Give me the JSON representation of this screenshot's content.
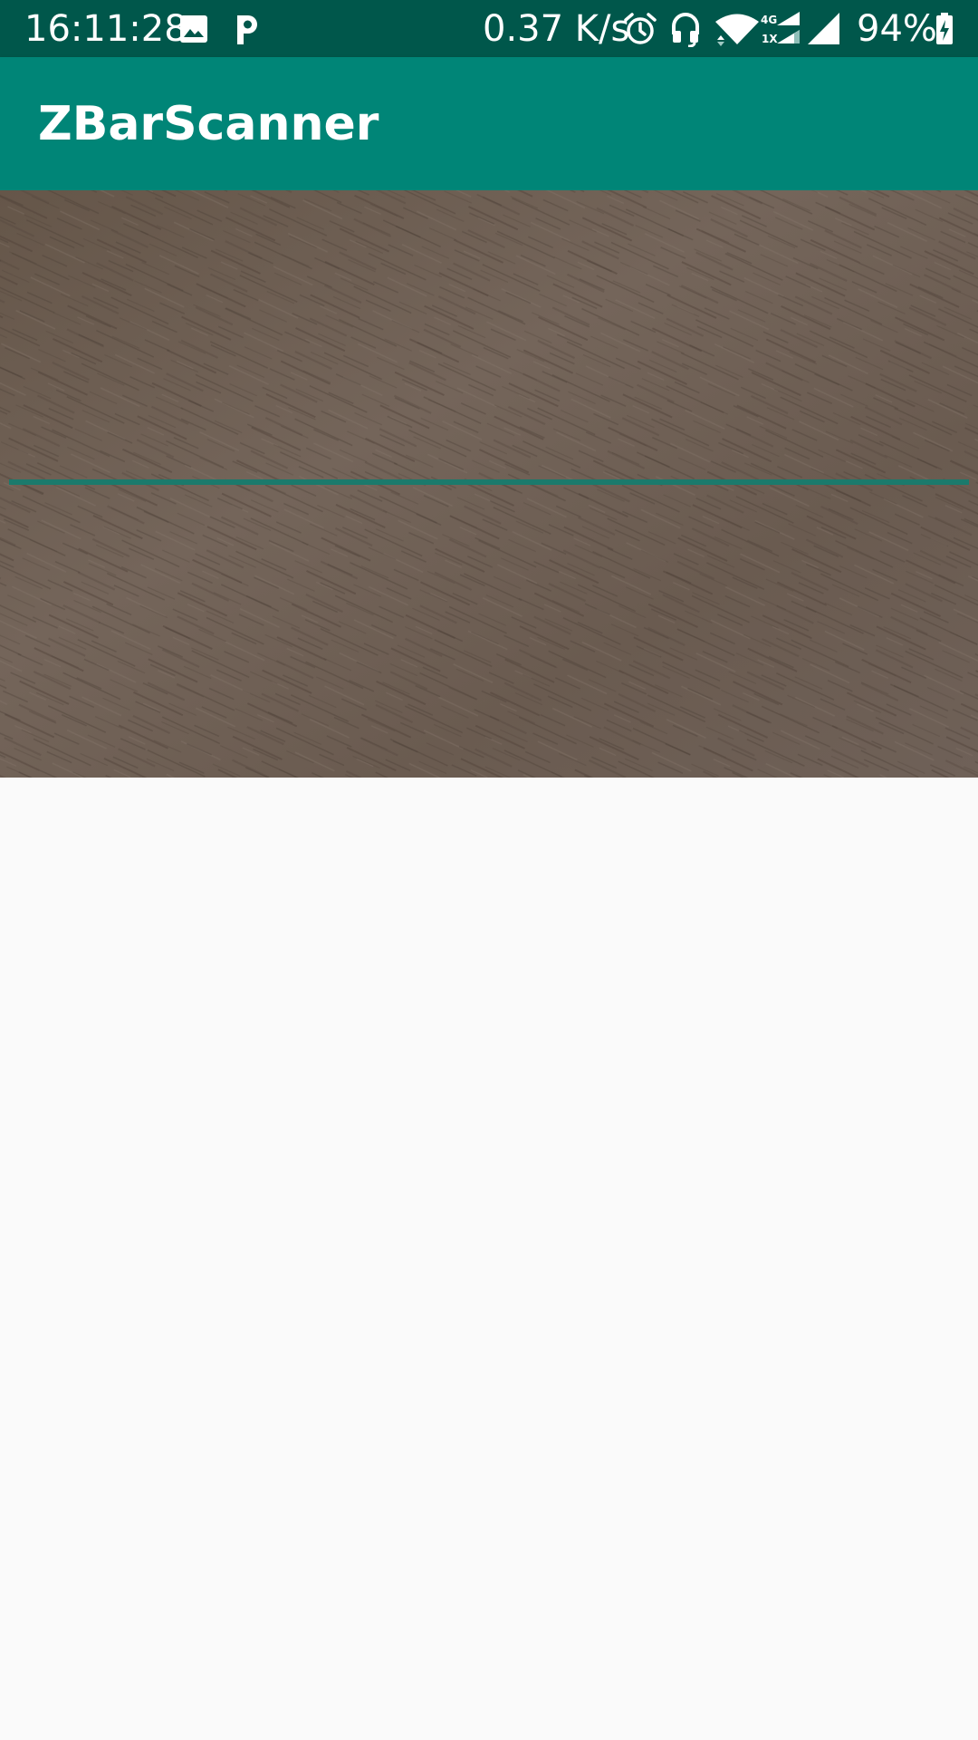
{
  "status_bar": {
    "time": "16:11:28",
    "net_speed": "0.37 K/s",
    "network_4g": "4G",
    "network_1x": "1X",
    "battery": "94%",
    "icons": [
      "image-icon",
      "p-app-icon",
      "alarm-icon",
      "headset-icon",
      "wifi-icon",
      "signal-icon",
      "battery-charging-icon"
    ]
  },
  "app_bar": {
    "title": "ZBarScanner"
  },
  "colors": {
    "status_bar": "#00574b",
    "app_bar": "#008577",
    "scan_line": "#1b7a6c",
    "background": "#fafafa"
  }
}
